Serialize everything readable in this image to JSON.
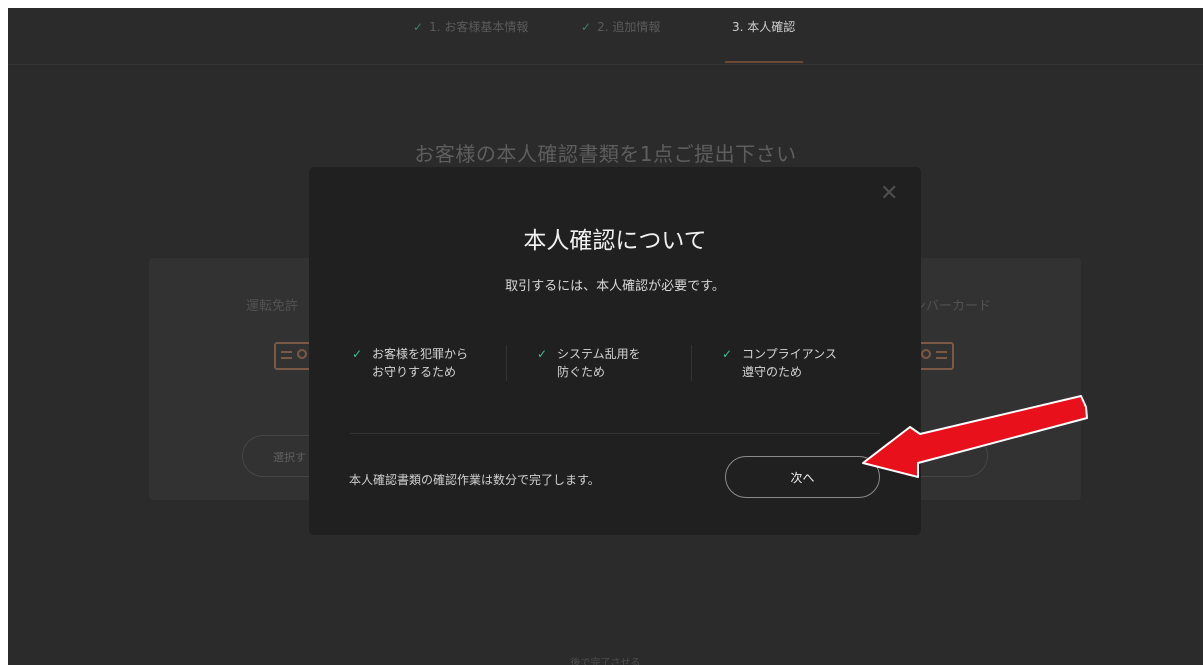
{
  "steps": [
    {
      "label": "1. お客様基本情報",
      "done": true
    },
    {
      "label": "2. 追加情報",
      "done": true
    },
    {
      "label": "3. 本人確認",
      "done": false
    }
  ],
  "step_check_icon": "check-icon",
  "page": {
    "heading": "お客様の本人確認書類を1点ご提出下さい",
    "cards": [
      {
        "label": "運転免許",
        "button": "選択す"
      },
      {
        "label": "ンバーカード",
        "button": ""
      }
    ],
    "later_link": "後で完了させる"
  },
  "modal": {
    "title": "本人確認について",
    "subtitle": "取引するには、本人確認が必要です。",
    "reasons": [
      {
        "text": "お客様を犯罪から\nお守りするため"
      },
      {
        "text": "システム乱用を\n防ぐため"
      },
      {
        "text": "コンプライアンス\n遵守のため"
      }
    ],
    "note": "本人確認書類の確認作業は数分で完了します。",
    "next_label": "次へ",
    "close_icon": "close-icon"
  },
  "annotation": {
    "color": "#e8101a",
    "icon": "red-arrow"
  },
  "colors": {
    "background": "#2b2b2b",
    "modal": "#202020",
    "check": "#3ec18b",
    "accent_underline": "#6a4a34"
  }
}
